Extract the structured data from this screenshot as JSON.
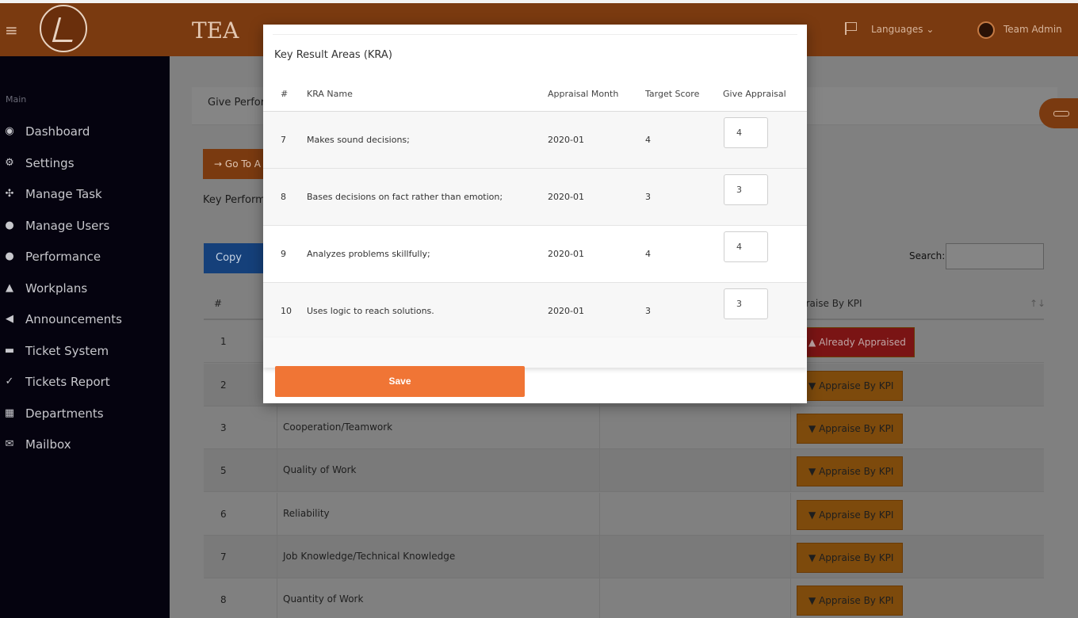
{
  "topbar": {
    "brand": "TEA",
    "languages_label": "Languages",
    "admin_name": "Team Admin"
  },
  "sidebar": {
    "heading": "Main",
    "items": [
      {
        "label": "Dashboard",
        "icon": "dashboard-icon"
      },
      {
        "label": "Settings",
        "icon": "gears-icon"
      },
      {
        "label": "Manage Task",
        "icon": "tasks-icon"
      },
      {
        "label": "Manage Users",
        "icon": "users-icon"
      },
      {
        "label": "Performance",
        "icon": "users-icon"
      },
      {
        "label": "Workplans",
        "icon": "user-icon"
      },
      {
        "label": "Announcements",
        "icon": "bullhorn-icon"
      },
      {
        "label": "Ticket System",
        "icon": "ticket-icon"
      },
      {
        "label": "Tickets Report",
        "icon": "check-circle-icon"
      },
      {
        "label": "Departments",
        "icon": "building-icon"
      },
      {
        "label": "Mailbox",
        "icon": "envelope-icon"
      }
    ]
  },
  "main": {
    "card_title": "Give Perfor",
    "goto_button": "Go To A",
    "kpi_heading": "Key Perform",
    "copy_button": "Copy",
    "search_label": "Search:",
    "table": {
      "col_num": "#",
      "col_kpi": "praise By KPI",
      "sort_glyph": "↑↓",
      "rows": [
        {
          "num": "1",
          "name": "",
          "action": "Already Appraised",
          "status": "done"
        },
        {
          "num": "2",
          "name": "",
          "action": "Appraise By KPI",
          "status": "pending"
        },
        {
          "num": "3",
          "name": "Cooperation/Teamwork",
          "action": "Appraise By KPI",
          "status": "pending"
        },
        {
          "num": "5",
          "name": "Quality of Work",
          "action": "Appraise By KPI",
          "status": "pending"
        },
        {
          "num": "6",
          "name": "Reliability",
          "action": "Appraise By KPI",
          "status": "pending"
        },
        {
          "num": "7",
          "name": "Job Knowledge/Technical Knowledge",
          "action": "Appraise By KPI",
          "status": "pending"
        },
        {
          "num": "8",
          "name": "Quantity of Work",
          "action": "Appraise By KPI",
          "status": "pending"
        }
      ]
    }
  },
  "modal": {
    "title": "Key Result Areas (KRA)",
    "columns": {
      "num": "#",
      "name": "KRA Name",
      "month": "Appraisal Month",
      "target": "Target Score",
      "give": "Give Appraisal"
    },
    "rows": [
      {
        "num": "7",
        "name": "Makes sound decisions;",
        "month": "2020-01",
        "target": "4",
        "value": "4"
      },
      {
        "num": "8",
        "name": "Bases decisions on fact rather than emotion;",
        "month": "2020-01",
        "target": "3",
        "value": "3"
      },
      {
        "num": "9",
        "name": "Analyzes problems skillfully;",
        "month": "2020-01",
        "target": "4",
        "value": "4"
      },
      {
        "num": "10",
        "name": "Uses logic to reach solutions.",
        "month": "2020-01",
        "target": "3",
        "value": "3"
      }
    ],
    "save_label": "Save"
  },
  "colors": {
    "topbar": "#7a3a10",
    "sidebar": "#05030f",
    "save_button": "#f07535",
    "appraise_button": "#e8890f",
    "appraised_button": "#d62b2b"
  }
}
